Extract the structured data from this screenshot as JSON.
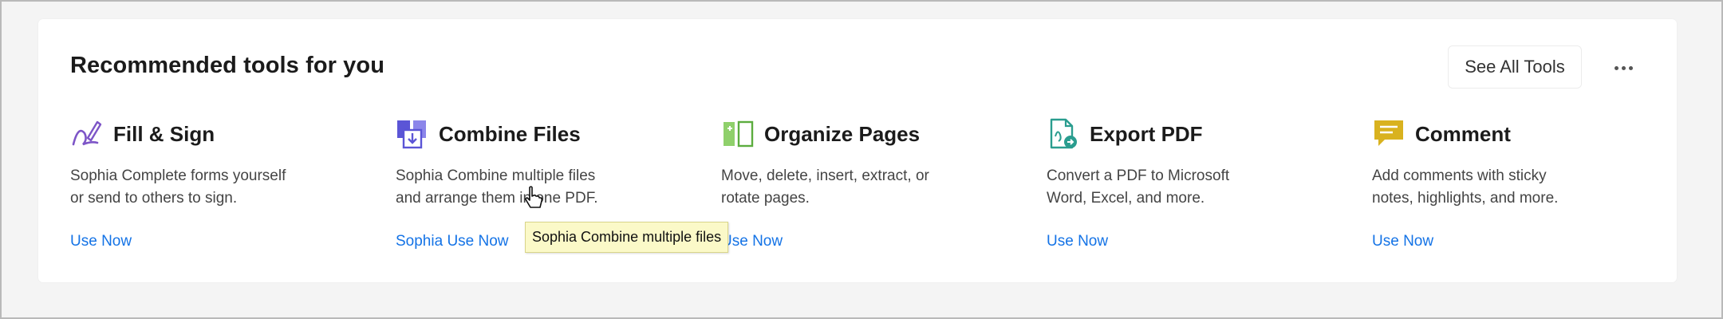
{
  "panel": {
    "title": "Recommended tools for you",
    "see_all_label": "See All Tools"
  },
  "tools": [
    {
      "name": "Fill & Sign",
      "desc_line1": "Sophia Complete forms yourself",
      "desc_line2": "or send to others to sign.",
      "link": "Use Now",
      "icon": "pen-signature-icon",
      "color": "#7d55c7"
    },
    {
      "name": "Combine Files",
      "desc_line1": "Sophia Combine multiple files",
      "desc_line2": "and arrange them in one PDF.",
      "link": "Sophia Use Now",
      "icon": "combine-files-icon",
      "color": "#5b55d6"
    },
    {
      "name": "Organize Pages",
      "desc_line1": "Move, delete, insert, extract, or",
      "desc_line2": "rotate pages.",
      "link": "Use Now",
      "icon": "organize-pages-icon",
      "color": "#5cad3f"
    },
    {
      "name": "Export PDF",
      "desc_line1": "Convert a PDF to Microsoft",
      "desc_line2": "Word, Excel, and more.",
      "link": "Use Now",
      "icon": "export-pdf-icon",
      "color": "#2a9d8f"
    },
    {
      "name": "Comment",
      "desc_line1": "Add comments with sticky",
      "desc_line2": "notes, highlights, and more.",
      "link": "Use Now",
      "icon": "comment-icon",
      "color": "#d9b21f"
    }
  ],
  "tooltip": {
    "text": "Sophia Combine multiple files"
  },
  "colors": {
    "link": "#1473e6",
    "tooltip_bg": "#fbf9c8"
  }
}
